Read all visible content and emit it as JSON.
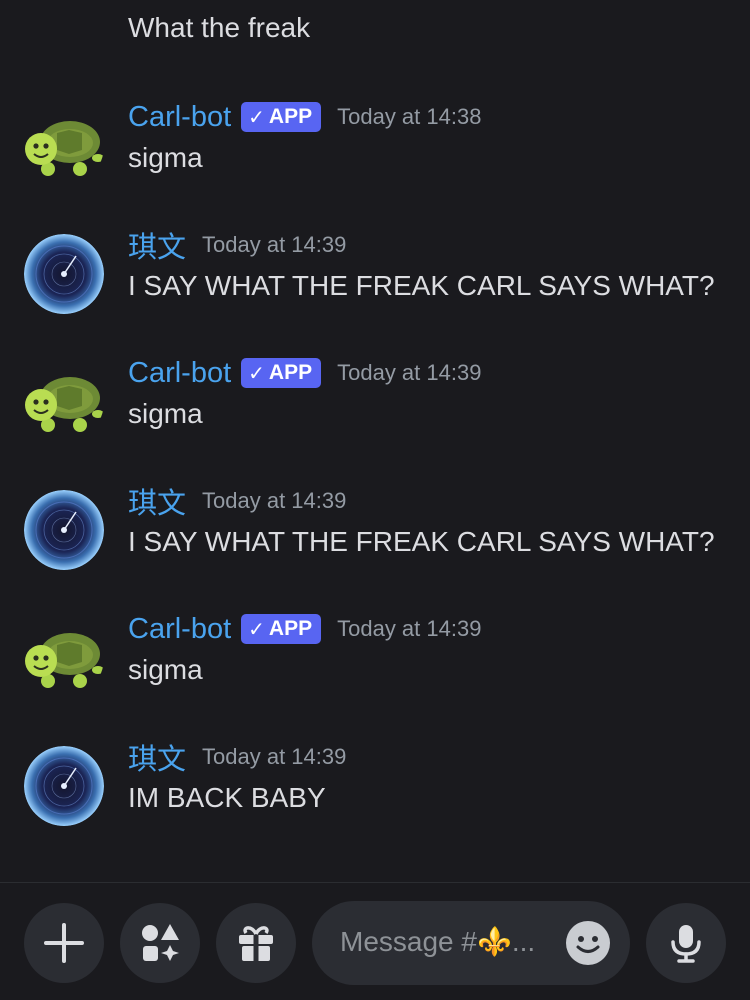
{
  "chat": {
    "continuation_text": "What the freak",
    "messages": [
      {
        "author": "Carl-bot",
        "badge": "APP",
        "timestamp": "Today at 14:38",
        "text": "sigma",
        "avatar": "turtle-avatar"
      },
      {
        "author": "琪文",
        "badge": null,
        "timestamp": "Today at 14:39",
        "text": "I SAY WHAT THE FREAK CARL SAYS WHAT?",
        "avatar": "galaxy-avatar"
      },
      {
        "author": "Carl-bot",
        "badge": "APP",
        "timestamp": "Today at 14:39",
        "text": "sigma",
        "avatar": "turtle-avatar"
      },
      {
        "author": "琪文",
        "badge": null,
        "timestamp": "Today at 14:39",
        "text": "I SAY WHAT THE FREAK CARL SAYS WHAT?",
        "avatar": "galaxy-avatar"
      },
      {
        "author": "Carl-bot",
        "badge": "APP",
        "timestamp": "Today at 14:39",
        "text": "sigma",
        "avatar": "turtle-avatar"
      },
      {
        "author": "琪文",
        "badge": null,
        "timestamp": "Today at 14:39",
        "text": "IM BACK BABY",
        "avatar": "galaxy-avatar"
      }
    ]
  },
  "composer": {
    "placeholder": "Message #⚜️...",
    "buttons": [
      "plus-icon",
      "apps-icon",
      "gift-icon",
      "emoji-icon",
      "microphone-icon"
    ]
  },
  "colors": {
    "background": "#1a1a1e",
    "username": "#4aa3ee",
    "app_badge": "#5865f2",
    "text": "#dcdde1",
    "timestamp": "#949ba4",
    "input_background": "#2b2d33"
  }
}
